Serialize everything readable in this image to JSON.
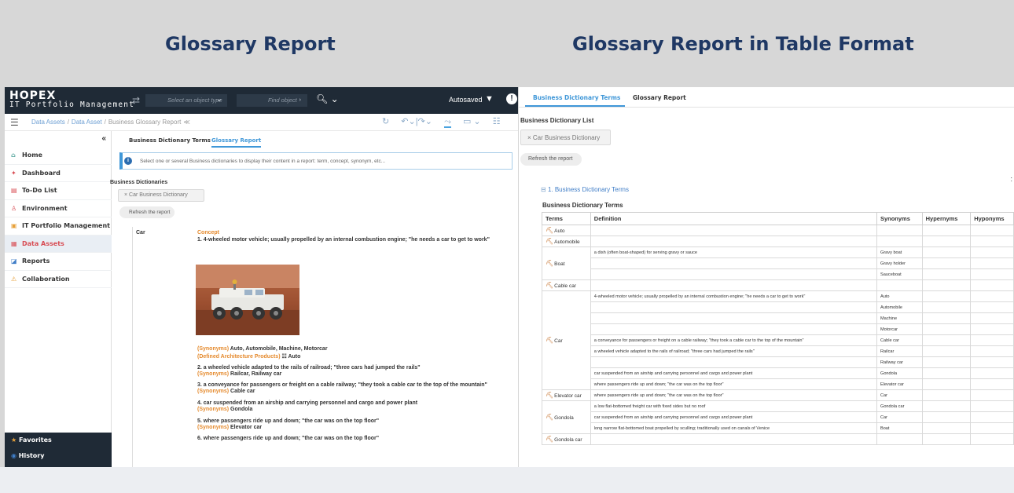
{
  "captions": {
    "left": "Glossary Report",
    "right": "Glossary Report in Table Format"
  },
  "left": {
    "app": {
      "logo": "HOPEX",
      "subtitle": "IT Portfolio Management"
    },
    "topbar": {
      "object_type_placeholder": "Select an object type",
      "find_placeholder": "Find object",
      "autosaved": "Autosaved"
    },
    "breadcrumb": [
      "Data Assets",
      "Data Asset",
      "Business Glossary Report"
    ],
    "sidebar": {
      "collapse": "«",
      "items": [
        {
          "label": "Home",
          "icon": "home-icon"
        },
        {
          "label": "Dashboard",
          "icon": "dashboard-icon"
        },
        {
          "label": "To-Do List",
          "icon": "todo-icon"
        },
        {
          "label": "Environment",
          "icon": "environment-icon"
        },
        {
          "label": "IT Portfolio Management",
          "icon": "portfolio-icon"
        },
        {
          "label": "Data Assets",
          "icon": "data-assets-icon",
          "active": true
        },
        {
          "label": "Reports",
          "icon": "reports-icon"
        },
        {
          "label": "Collaboration",
          "icon": "collaboration-icon"
        }
      ],
      "bottom": [
        {
          "label": "Favorites",
          "icon": "star-icon"
        },
        {
          "label": "History",
          "icon": "history-icon"
        }
      ]
    },
    "tabs": [
      "Business Dictionary Terms",
      "Glossary Report"
    ],
    "active_tab": "Glossary Report",
    "notice": "Select one or several Business dictionaries to display their content in a report: term, concept, synonym, etc...",
    "dictionaries_title": "Business Dictionaries",
    "dictionary_chip": "Car Business Dictionary",
    "refresh_button": "Refresh the report",
    "report": {
      "term": "Car",
      "concept_label": "Concept",
      "def1": "1. 4-wheeled motor vehicle; usually propelled by an internal combustion engine; \"he needs a car to get to work\"",
      "syn1_label": "(Synonyms)",
      "syn1": "Auto, Automobile, Machine, Motorcar",
      "dap_label": "(Defined Architecture Products)",
      "dap": "Auto",
      "def2": "2. a wheeled vehicle adapted to the rails of railroad; \"three cars had jumped the rails\"",
      "syn2": "Railcar, Railway car",
      "def3": "3. a conveyance for passengers or freight on a cable railway; \"they took a cable car to the top of the mountain\"",
      "syn3": "Cable car",
      "def4": "4. car suspended from an airship and carrying personnel and cargo and power plant",
      "syn4": "Gondola",
      "def5": "5. where passengers ride up and down; \"the car was on the top floor\"",
      "syn5": "Elevator car",
      "def6": "6. where passengers ride up and down; \"the car was on the top floor\""
    }
  },
  "right": {
    "tabs": [
      "Business Dictionary Terms",
      "Glossary Report"
    ],
    "active_tab": "Business Dictionary Terms",
    "list_title": "Business Dictionary List",
    "dictionary_chip": "Car Business Dictionary",
    "refresh_button": "Refresh the report",
    "section": "1. Business Dictionary Terms",
    "table_title": "Business Dictionary Terms",
    "columns": [
      "Terms",
      "Definition",
      "Synonyms",
      "Hypernyms",
      "Hyponyms"
    ],
    "rows": [
      {
        "term": "Auto",
        "definition": "",
        "synonym": ""
      },
      {
        "term": "Automobile",
        "definition": "",
        "synonym": ""
      },
      {
        "term": "Boat",
        "definition": "a dish (often boat-shaped) for serving gravy or sauce",
        "synonym": "Gravy boat"
      },
      {
        "term": "",
        "definition": "",
        "synonym": "Gravy holder"
      },
      {
        "term": "",
        "definition": "",
        "synonym": "Sauceboat"
      },
      {
        "term": "Cable car",
        "definition": "",
        "synonym": ""
      },
      {
        "term": "Car",
        "definition": "4-wheeled motor vehicle; usually propelled by an internal combustion engine; \"he needs a car to get to work\"",
        "synonym": "Auto"
      },
      {
        "term": "",
        "definition": "",
        "synonym": "Automobile"
      },
      {
        "term": "",
        "definition": "",
        "synonym": "Machine"
      },
      {
        "term": "",
        "definition": "",
        "synonym": "Motorcar"
      },
      {
        "term": "",
        "definition": "a conveyance for passengers or freight on a cable railway; \"they took a cable car to the top of the mountain\"",
        "synonym": "Cable car"
      },
      {
        "term": "",
        "definition": "a wheeled vehicle adapted to the rails of railroad; \"three cars had jumped the rails\"",
        "synonym": "Railcar"
      },
      {
        "term": "",
        "definition": "",
        "synonym": "Railway car"
      },
      {
        "term": "",
        "definition": "car suspended from an airship and carrying personnel and cargo and power plant",
        "synonym": "Gondola"
      },
      {
        "term": "",
        "definition": "where passengers ride up and down; \"the car was on the top floor\"",
        "synonym": "Elevator car"
      },
      {
        "term": "Elevator car",
        "definition": "where passengers ride up and down; \"the car was on the top floor\"",
        "synonym": "Car"
      },
      {
        "term": "Gondola",
        "definition": "a low flat-bottomed freight car with fixed sides but no roof",
        "synonym": "Gondola car"
      },
      {
        "term": "",
        "definition": "car suspended from an airship and carrying personnel and cargo and power plant",
        "synonym": "Car"
      },
      {
        "term": "",
        "definition": "long narrow flat-bottomed boat propelled by sculling; traditionally used on canals of Venice",
        "synonym": "Boat"
      },
      {
        "term": "Gondola car",
        "definition": "",
        "synonym": ""
      }
    ]
  }
}
